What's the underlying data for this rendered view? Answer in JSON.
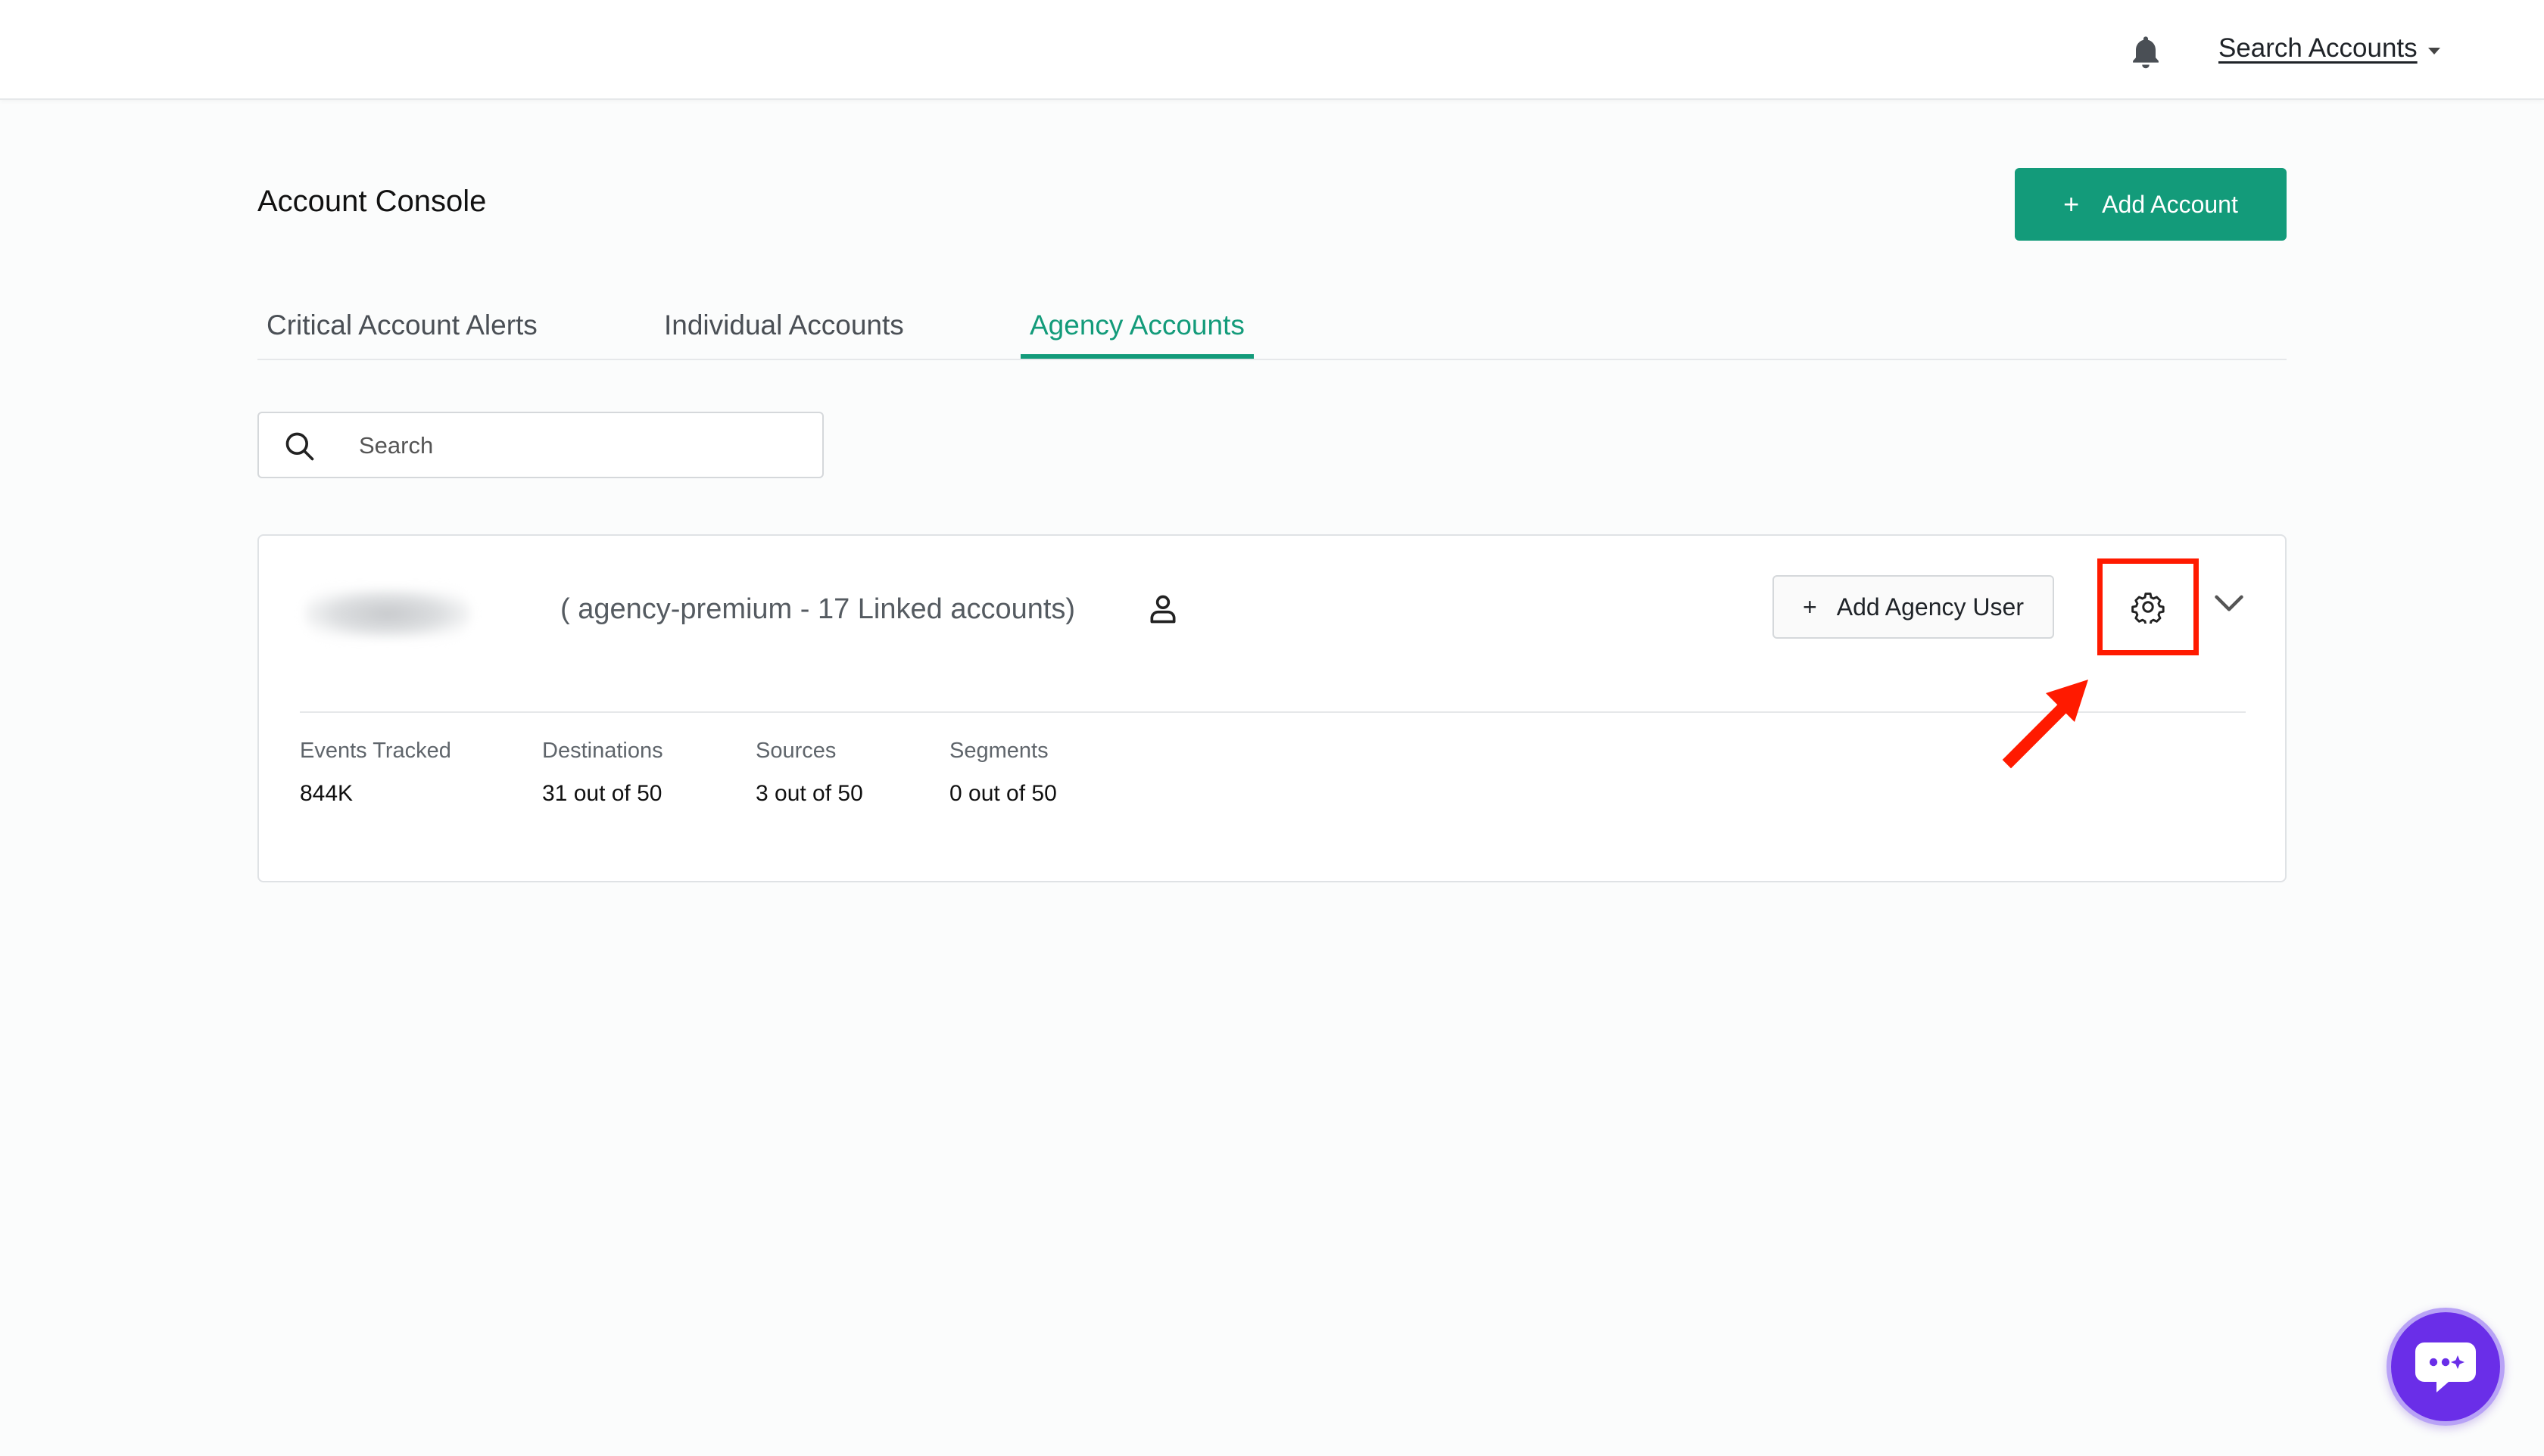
{
  "header": {
    "search_accounts_label": "Search Accounts"
  },
  "page": {
    "title": "Account Console",
    "add_account_label": "Add Account",
    "add_account_plus": "+"
  },
  "tabs": [
    {
      "label": "Critical Account Alerts",
      "active": false
    },
    {
      "label": "Individual Accounts",
      "active": false
    },
    {
      "label": "Agency Accounts",
      "active": true
    }
  ],
  "search": {
    "placeholder": "Search",
    "value": ""
  },
  "agency_card": {
    "meta": "( agency-premium - 17 Linked accounts)",
    "add_user_label": "Add Agency User",
    "add_user_plus": "+",
    "stats": [
      {
        "label": "Events Tracked",
        "value": "844K"
      },
      {
        "label": "Destinations",
        "value": "31 out of 50"
      },
      {
        "label": "Sources",
        "value": "3 out of 50"
      },
      {
        "label": "Segments",
        "value": "0 out of 50"
      }
    ]
  },
  "colors": {
    "accent": "#139b7a",
    "annotation": "#ff1a00",
    "chat": "#6a2ee8"
  },
  "icons": {
    "bell": "bell-icon",
    "search": "search-icon",
    "user": "user-icon",
    "gear": "gear-icon",
    "chevron": "chevron-down-icon",
    "chat": "chat-icon"
  }
}
